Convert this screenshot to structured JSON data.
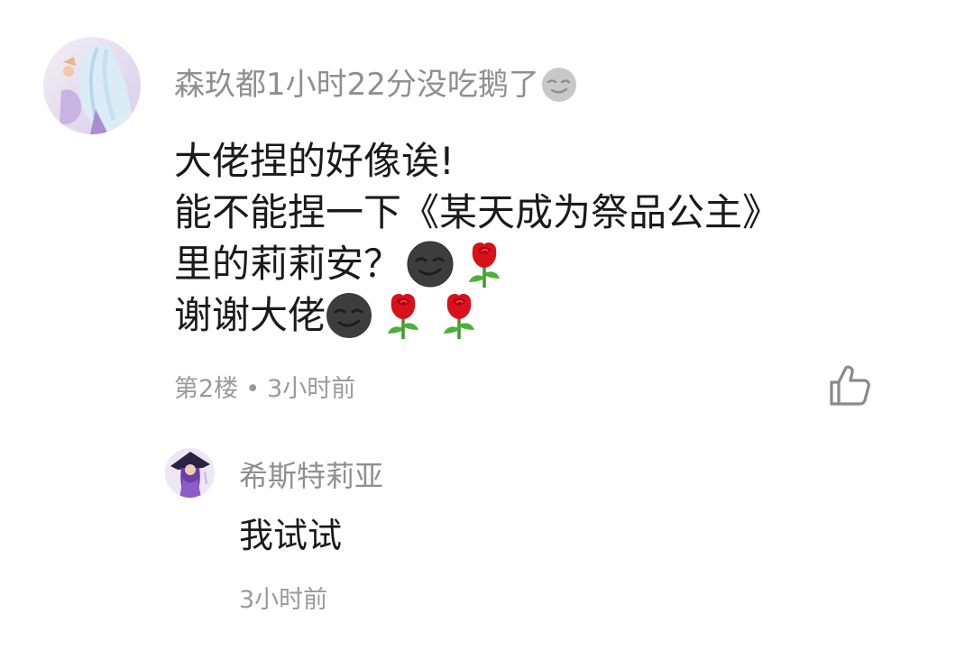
{
  "comment": {
    "username": "森玖都1小时22分没吃鹅了",
    "username_flair_icon": "smirk-moon-face-icon",
    "lines": [
      {
        "text": "大佬捏的好像诶!",
        "emojis": []
      },
      {
        "text": "能不能捏一下《某天成为祭品公主》",
        "emojis": []
      },
      {
        "text": "里的莉莉安？",
        "emojis": [
          "smirk-moon-face-icon",
          "rose-icon"
        ]
      },
      {
        "text": "谢谢大佬",
        "emojis": [
          "smirk-moon-face-icon",
          "rose-icon",
          "rose-icon"
        ]
      }
    ],
    "floor": "第2楼",
    "separator": "•",
    "time": "3小时前",
    "like_icon": "thumbs-up-icon"
  },
  "reply": {
    "username": "希斯特莉亚",
    "text": "我试试",
    "time": "3小时前"
  },
  "colors": {
    "username": "#8f8f8f",
    "body_text": "#1a1a1a",
    "meta_text": "#9a9a9a",
    "rose": "#d8111b",
    "stem": "#3f9a2e",
    "moon_face": "#3d3d3d"
  }
}
